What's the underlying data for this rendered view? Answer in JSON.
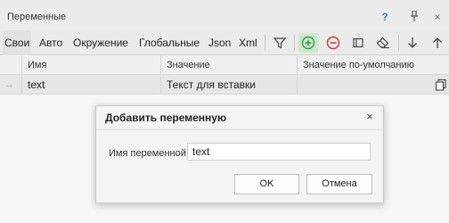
{
  "panel": {
    "title": "Переменные",
    "help_icon": "?",
    "pin_icon": "pin-icon",
    "close_icon": "×"
  },
  "tabs": [
    {
      "label": "Свои",
      "active": true
    },
    {
      "label": "Авто"
    },
    {
      "label": "Окружение"
    },
    {
      "label": "Глобальные"
    },
    {
      "label": "Json"
    },
    {
      "label": "Xml"
    }
  ],
  "toolbar_icons": [
    "filter-icon",
    "add-icon",
    "remove-icon",
    "columns-icon",
    "eraser-icon",
    "arrow-down-icon",
    "arrow-up-icon"
  ],
  "table": {
    "columns": [
      "Имя",
      "Значение",
      "Значение по-умолчанию"
    ],
    "rows": [
      {
        "name": "text",
        "value": "Текст для вставки",
        "default": ""
      }
    ]
  },
  "dialog": {
    "title": "Добавить переменную",
    "close": "×",
    "field_label": "Имя переменной",
    "field_value": "text",
    "ok_label": "OK",
    "cancel_label": "Отмена"
  },
  "colors": {
    "accent_add": "#2e9b4e",
    "accent_remove": "#d33434",
    "highlight": "#cfe6cf"
  }
}
